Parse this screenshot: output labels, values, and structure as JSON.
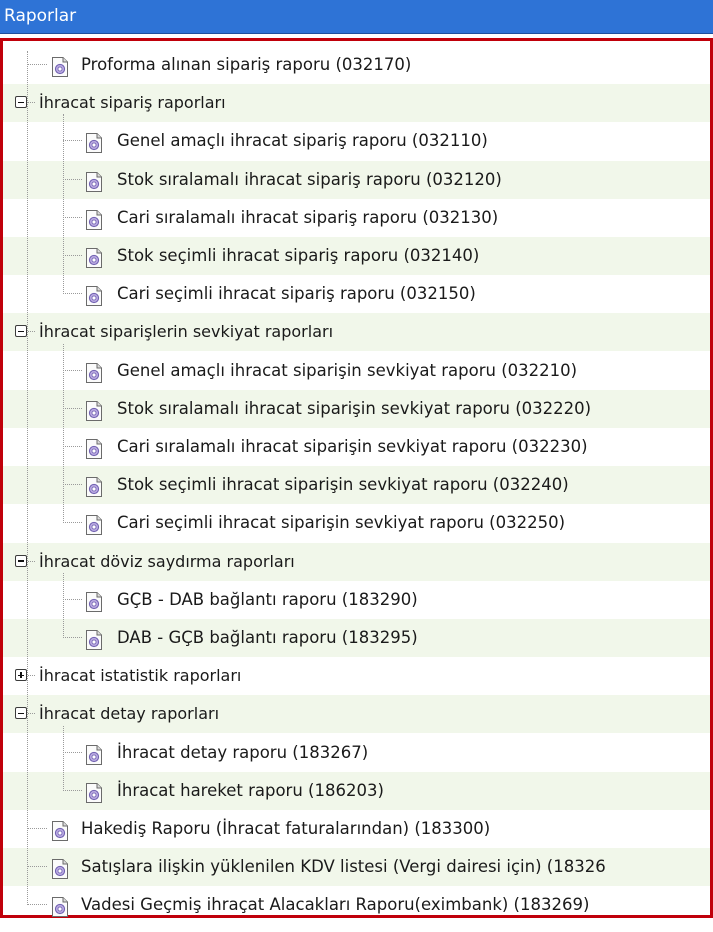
{
  "title": "Raporlar",
  "tree": [
    {
      "kind": "leaf",
      "label": "Proforma alınan sipariş raporu (032170)",
      "icon": "report-doc-icon"
    },
    {
      "kind": "group",
      "label": "İhracat sipariş raporları",
      "expanded": true,
      "children": [
        {
          "label": "Genel amaçlı ihracat sipariş raporu (032110)",
          "icon": "report-doc-icon"
        },
        {
          "label": "Stok sıralamalı ihracat sipariş raporu (032120)",
          "icon": "report-doc-icon"
        },
        {
          "label": "Cari sıralamalı ihracat sipariş raporu (032130)",
          "icon": "report-doc-icon"
        },
        {
          "label": "Stok seçimli ihracat sipariş raporu (032140)",
          "icon": "report-doc-icon"
        },
        {
          "label": "Cari seçimli ihracat sipariş raporu (032150)",
          "icon": "report-doc-icon"
        }
      ]
    },
    {
      "kind": "group",
      "label": "İhracat siparişlerin sevkiyat raporları",
      "expanded": true,
      "children": [
        {
          "label": "Genel amaçlı ihracat siparişin sevkiyat raporu (032210)",
          "icon": "report-doc-icon"
        },
        {
          "label": "Stok sıralamalı ihracat siparişin sevkiyat raporu (032220)",
          "icon": "report-doc-icon"
        },
        {
          "label": "Cari sıralamalı ihracat siparişin sevkiyat raporu (032230)",
          "icon": "report-doc-icon"
        },
        {
          "label": "Stok seçimli ihracat siparişin sevkiyat raporu (032240)",
          "icon": "report-doc-icon"
        },
        {
          "label": "Cari seçimli ihracat siparişin sevkiyat raporu (032250)",
          "icon": "report-doc-icon"
        }
      ]
    },
    {
      "kind": "group",
      "label": "İhracat döviz saydırma raporları",
      "expanded": true,
      "children": [
        {
          "label": "GÇB - DAB bağlantı raporu (183290)",
          "icon": "report-doc-icon"
        },
        {
          "label": "DAB - GÇB bağlantı raporu (183295)",
          "icon": "report-doc-icon"
        }
      ]
    },
    {
      "kind": "group",
      "label": "İhracat istatistik raporları",
      "expanded": false,
      "children": []
    },
    {
      "kind": "group",
      "label": "İhracat detay raporları",
      "expanded": true,
      "children": [
        {
          "label": "İhracat detay raporu (183267)",
          "icon": "report-doc-icon"
        },
        {
          "label": "İhracat hareket raporu (186203)",
          "icon": "report-doc-icon"
        }
      ]
    },
    {
      "kind": "leaf",
      "label": "Hakediş Raporu (İhracat faturalarından) (183300)",
      "icon": "report-doc-icon"
    },
    {
      "kind": "leaf",
      "label": "Satışlara ilişkin yüklenilen KDV listesi (Vergi dairesi için) (18326",
      "icon": "report-doc-icon"
    },
    {
      "kind": "leaf",
      "label": "Vadesi Geçmiş ihraçat Alacakları Raporu(eximbank) (183269)",
      "icon": "report-doc-icon"
    }
  ],
  "colors": {
    "titlebar": "#2e73d6",
    "frame": "#c0000a",
    "alt_row": "#f1f7ea"
  }
}
